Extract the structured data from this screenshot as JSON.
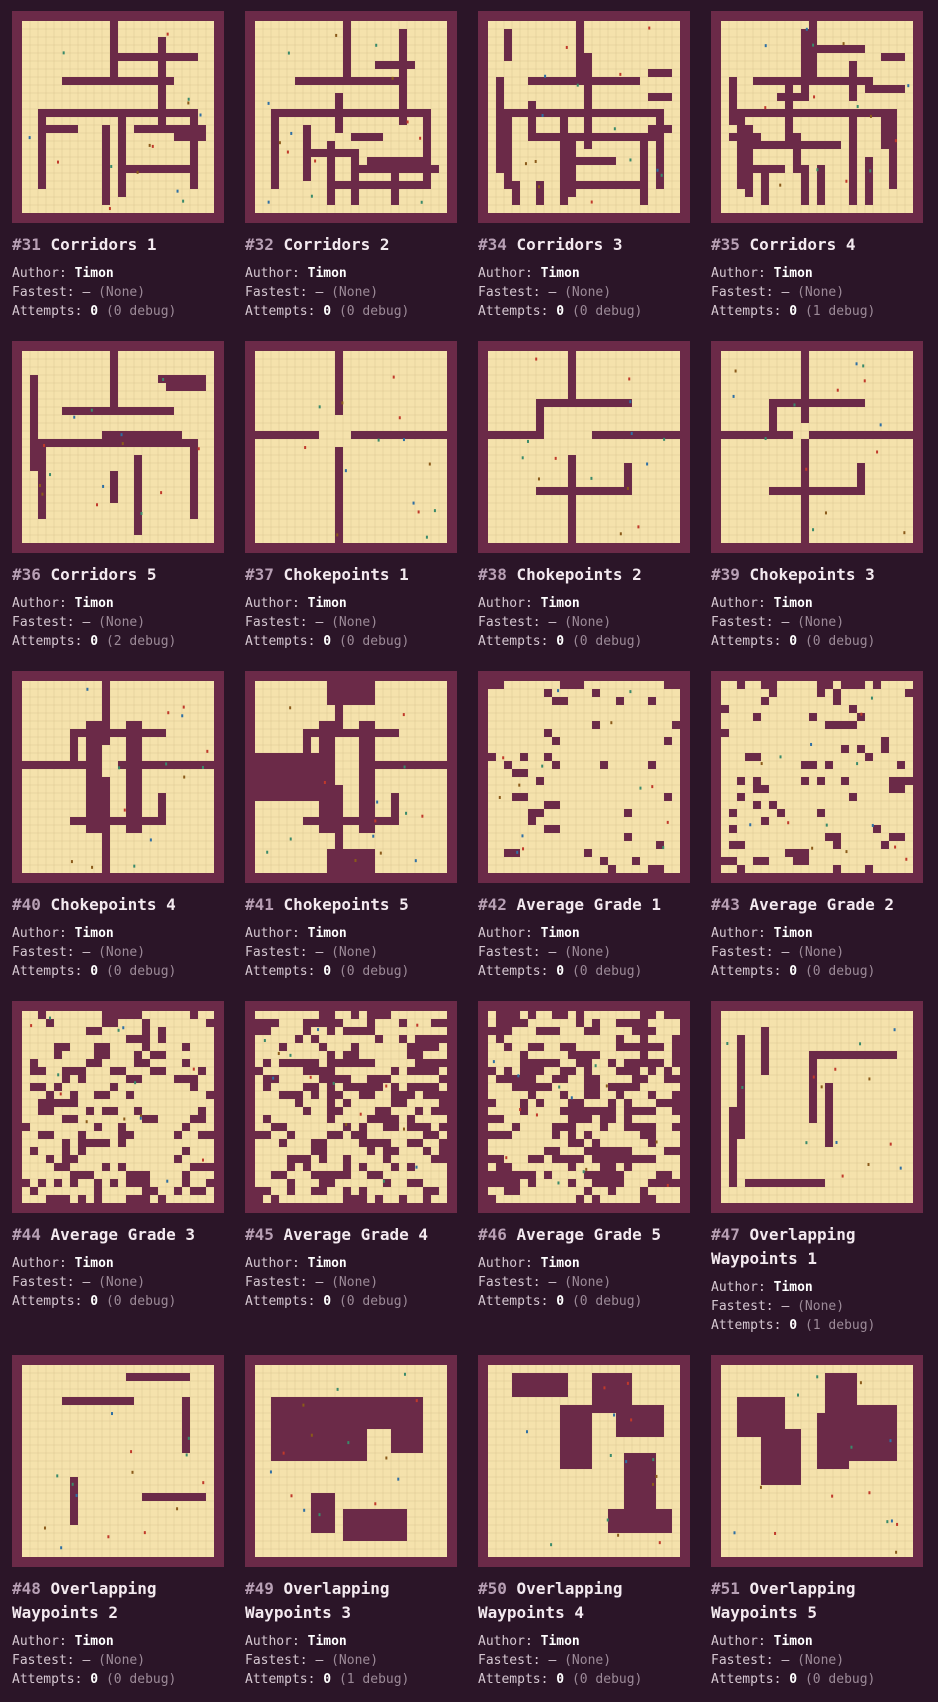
{
  "labels": {
    "author": "Author:",
    "fastest": "Fastest:",
    "attempts": "Attempts:",
    "fastest_dash": "–"
  },
  "colors": {
    "background": "#2b1528",
    "wall": "#6b2a48",
    "floor": "#f5e2ac",
    "gridline": "#dcc792"
  },
  "maps": [
    {
      "number": "#31",
      "name": "Corridors 1",
      "author": "Timon",
      "fastest": "(None)",
      "attempts": "0",
      "debug": "(0 debug)",
      "style": "corridors",
      "seed": 31
    },
    {
      "number": "#32",
      "name": "Corridors 2",
      "author": "Timon",
      "fastest": "(None)",
      "attempts": "0",
      "debug": "(0 debug)",
      "style": "corridors",
      "seed": 32
    },
    {
      "number": "#34",
      "name": "Corridors 3",
      "author": "Timon",
      "fastest": "(None)",
      "attempts": "0",
      "debug": "(0 debug)",
      "style": "corridors",
      "seed": 34
    },
    {
      "number": "#35",
      "name": "Corridors 4",
      "author": "Timon",
      "fastest": "(None)",
      "attempts": "0",
      "debug": "(1 debug)",
      "style": "corridors",
      "seed": 35
    },
    {
      "number": "#36",
      "name": "Corridors 5",
      "author": "Timon",
      "fastest": "(None)",
      "attempts": "0",
      "debug": "(2 debug)",
      "style": "corridors",
      "seed": 36
    },
    {
      "number": "#37",
      "name": "Chokepoints 1",
      "author": "Timon",
      "fastest": "(None)",
      "attempts": "0",
      "debug": "(0 debug)",
      "style": "chokepoints",
      "seed": 37
    },
    {
      "number": "#38",
      "name": "Chokepoints 2",
      "author": "Timon",
      "fastest": "(None)",
      "attempts": "0",
      "debug": "(0 debug)",
      "style": "chokepoints",
      "seed": 38
    },
    {
      "number": "#39",
      "name": "Chokepoints 3",
      "author": "Timon",
      "fastest": "(None)",
      "attempts": "0",
      "debug": "(0 debug)",
      "style": "chokepoints",
      "seed": 39
    },
    {
      "number": "#40",
      "name": "Chokepoints 4",
      "author": "Timon",
      "fastest": "(None)",
      "attempts": "0",
      "debug": "(0 debug)",
      "style": "chokepoints",
      "seed": 40
    },
    {
      "number": "#41",
      "name": "Chokepoints 5",
      "author": "Timon",
      "fastest": "(None)",
      "attempts": "0",
      "debug": "(0 debug)",
      "style": "chokepoints",
      "seed": 41
    },
    {
      "number": "#42",
      "name": "Average Grade 1",
      "author": "Timon",
      "fastest": "(None)",
      "attempts": "0",
      "debug": "(0 debug)",
      "style": "random",
      "seed": 42
    },
    {
      "number": "#43",
      "name": "Average Grade 2",
      "author": "Timon",
      "fastest": "(None)",
      "attempts": "0",
      "debug": "(0 debug)",
      "style": "random",
      "seed": 43
    },
    {
      "number": "#44",
      "name": "Average Grade 3",
      "author": "Timon",
      "fastest": "(None)",
      "attempts": "0",
      "debug": "(0 debug)",
      "style": "random",
      "seed": 44
    },
    {
      "number": "#45",
      "name": "Average Grade 4",
      "author": "Timon",
      "fastest": "(None)",
      "attempts": "0",
      "debug": "(0 debug)",
      "style": "random",
      "seed": 45
    },
    {
      "number": "#46",
      "name": "Average Grade 5",
      "author": "Timon",
      "fastest": "(None)",
      "attempts": "0",
      "debug": "(0 debug)",
      "style": "random",
      "seed": 46
    },
    {
      "number": "#47",
      "name": "Overlapping Waypoints 1",
      "author": "Timon",
      "fastest": "(None)",
      "attempts": "0",
      "debug": "(1 debug)",
      "style": "overlap",
      "seed": 47
    },
    {
      "number": "#48",
      "name": "Overlapping Waypoints 2",
      "author": "Timon",
      "fastest": "(None)",
      "attempts": "0",
      "debug": "(0 debug)",
      "style": "overlap",
      "seed": 48
    },
    {
      "number": "#49",
      "name": "Overlapping Waypoints 3",
      "author": "Timon",
      "fastest": "(None)",
      "attempts": "0",
      "debug": "(1 debug)",
      "style": "overlap",
      "seed": 49
    },
    {
      "number": "#50",
      "name": "Overlapping Waypoints 4",
      "author": "Timon",
      "fastest": "(None)",
      "attempts": "0",
      "debug": "(0 debug)",
      "style": "overlap",
      "seed": 50
    },
    {
      "number": "#51",
      "name": "Overlapping Waypoints 5",
      "author": "Timon",
      "fastest": "(None)",
      "attempts": "0",
      "debug": "(0 debug)",
      "style": "overlap",
      "seed": 51
    }
  ]
}
